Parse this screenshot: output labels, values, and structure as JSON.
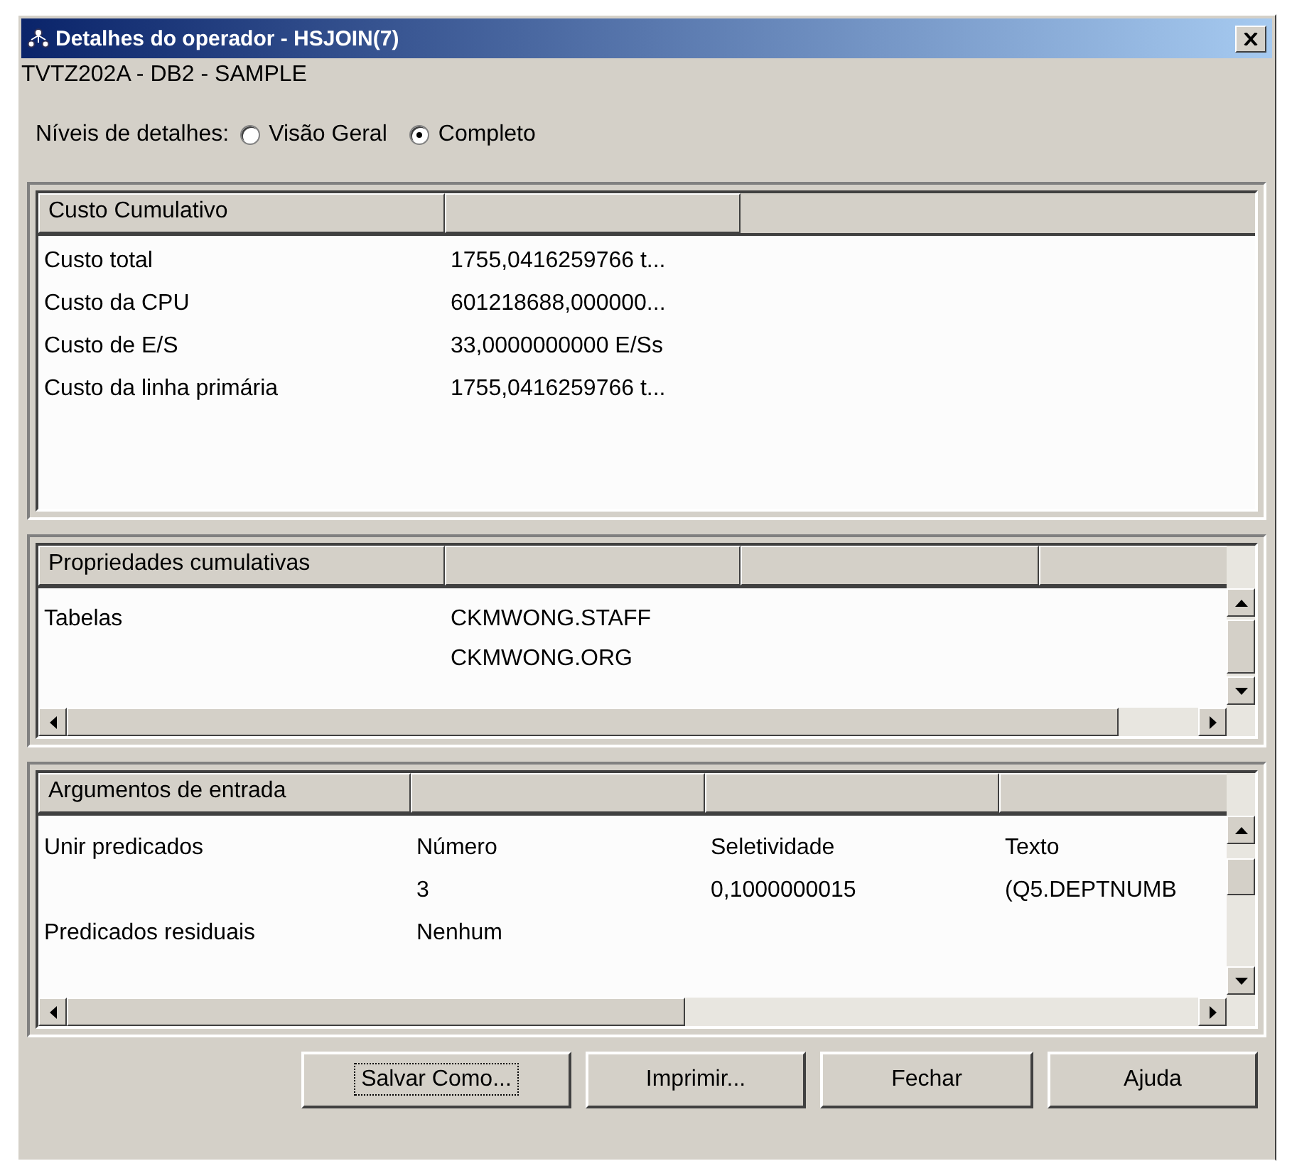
{
  "window": {
    "title": "Detalhes do operador - HSJOIN(7)"
  },
  "subtitle": "TVTZ202A - DB2 - SAMPLE",
  "detail_level": {
    "label": "Níveis de detalhes:",
    "options": [
      {
        "label": "Visão Geral",
        "selected": false
      },
      {
        "label": "Completo",
        "selected": true
      }
    ]
  },
  "panels": [
    {
      "columns": [
        {
          "label": "Custo Cumulativo"
        }
      ],
      "scroll": false,
      "rows": [
        [
          "Custo total",
          "1755,0416259766 t..."
        ],
        [
          "Custo da CPU",
          "601218688,000000..."
        ],
        [
          "Custo de E/S",
          "33,0000000000 E/Ss"
        ],
        [
          "Custo da linha primária",
          "1755,0416259766 t..."
        ]
      ]
    },
    {
      "columns": [
        {
          "label": "Propriedades cumulativas"
        }
      ],
      "scroll": true,
      "rows": [
        [
          "Tabelas",
          "CKMWONG.STAFF"
        ],
        [
          "",
          "CKMWONG.ORG"
        ]
      ]
    },
    {
      "columns": [
        {
          "label": "Argumentos de entrada"
        }
      ],
      "scroll": true,
      "rows": [
        [
          "Unir predicados",
          "Número",
          "Seletividade",
          "Texto"
        ],
        [
          "",
          "3",
          "0,1000000015",
          "(Q5.DEPTNUMB"
        ],
        [
          "Predicados residuais",
          "Nenhum"
        ]
      ]
    }
  ],
  "buttons": [
    {
      "label": "Salvar Como...",
      "focused": true
    },
    {
      "label": "Imprimir...",
      "focused": false
    },
    {
      "label": "Fechar",
      "focused": false
    },
    {
      "label": "Ajuda",
      "focused": false
    }
  ]
}
